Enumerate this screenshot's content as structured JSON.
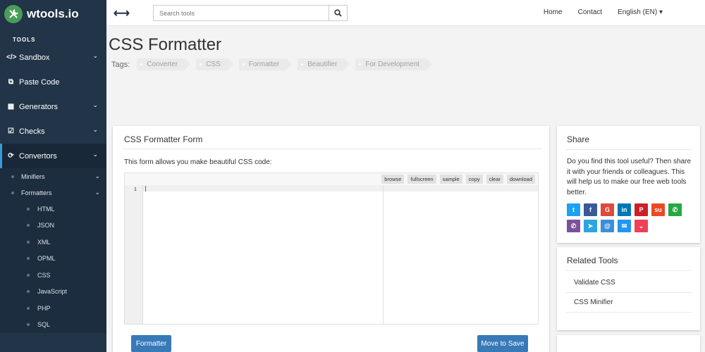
{
  "brand": {
    "name": "wtools.io"
  },
  "sidebar": {
    "header": "TOOLS",
    "items": [
      {
        "label": "Sandbox",
        "icon": "code-icon",
        "glyph": "</>",
        "chevron": true
      },
      {
        "label": "Paste Code",
        "icon": "paste-icon",
        "glyph": "⧉",
        "chevron": false
      },
      {
        "label": "Generators",
        "icon": "calculator-icon",
        "glyph": "▦",
        "chevron": true
      },
      {
        "label": "Checks",
        "icon": "checkbox-icon",
        "glyph": "☑",
        "chevron": true
      },
      {
        "label": "Convertors",
        "icon": "refresh-icon",
        "glyph": "⟳",
        "chevron": true
      }
    ],
    "subitems": [
      {
        "label": "Minifiers"
      },
      {
        "label": "Formatters"
      }
    ],
    "leaves": [
      "HTML",
      "JSON",
      "XML",
      "OPML",
      "CSS",
      "JavaScript",
      "PHP",
      "SQL"
    ]
  },
  "topbar": {
    "search_placeholder": "Search tools",
    "nav": [
      "Home",
      "Contact",
      "English (EN) ▾"
    ]
  },
  "page": {
    "title": "CSS Formatter",
    "tags_label": "Tags:",
    "tags": [
      "Converter",
      "CSS",
      "Formatter",
      "Beautifier",
      "For Development"
    ]
  },
  "form": {
    "title": "CSS Formatter Form",
    "description": "This form allows you make beautiful CSS code:",
    "toolbar": [
      "browse",
      "fullscreen",
      "sample",
      "copy",
      "clear",
      "download"
    ],
    "line_number": "1",
    "format_button": "Formatter",
    "save_button": "Move to Save"
  },
  "share": {
    "title": "Share",
    "text": "Do you find this tool useful? Then share it with your friends or colleagues. This will help us to make our free web tools better.",
    "row1": [
      {
        "name": "twitter-icon",
        "glyph": "t",
        "color": "#1da1f2"
      },
      {
        "name": "facebook-icon",
        "glyph": "f",
        "color": "#3b5998"
      },
      {
        "name": "google-plus-icon",
        "glyph": "G",
        "color": "#dd4b39"
      },
      {
        "name": "linkedin-icon",
        "glyph": "in",
        "color": "#0077b5"
      },
      {
        "name": "pinterest-icon",
        "glyph": "P",
        "color": "#cb2027"
      },
      {
        "name": "stumbleupon-icon",
        "glyph": "su",
        "color": "#eb4924"
      },
      {
        "name": "whatsapp-icon",
        "glyph": "✆",
        "color": "#25a744"
      }
    ],
    "row2": [
      {
        "name": "viber-icon",
        "glyph": "✆",
        "color": "#7b519d"
      },
      {
        "name": "telegram-icon",
        "glyph": "➤",
        "color": "#2ca5e0"
      },
      {
        "name": "email-icon",
        "glyph": "@",
        "color": "#3b8fd9"
      },
      {
        "name": "messenger-icon",
        "glyph": "✉",
        "color": "#2196f3"
      },
      {
        "name": "pocket-icon",
        "glyph": "⌄",
        "color": "#ef4056"
      }
    ]
  },
  "related": {
    "title": "Related Tools",
    "items": [
      "Validate CSS",
      "CSS Minifier"
    ]
  }
}
